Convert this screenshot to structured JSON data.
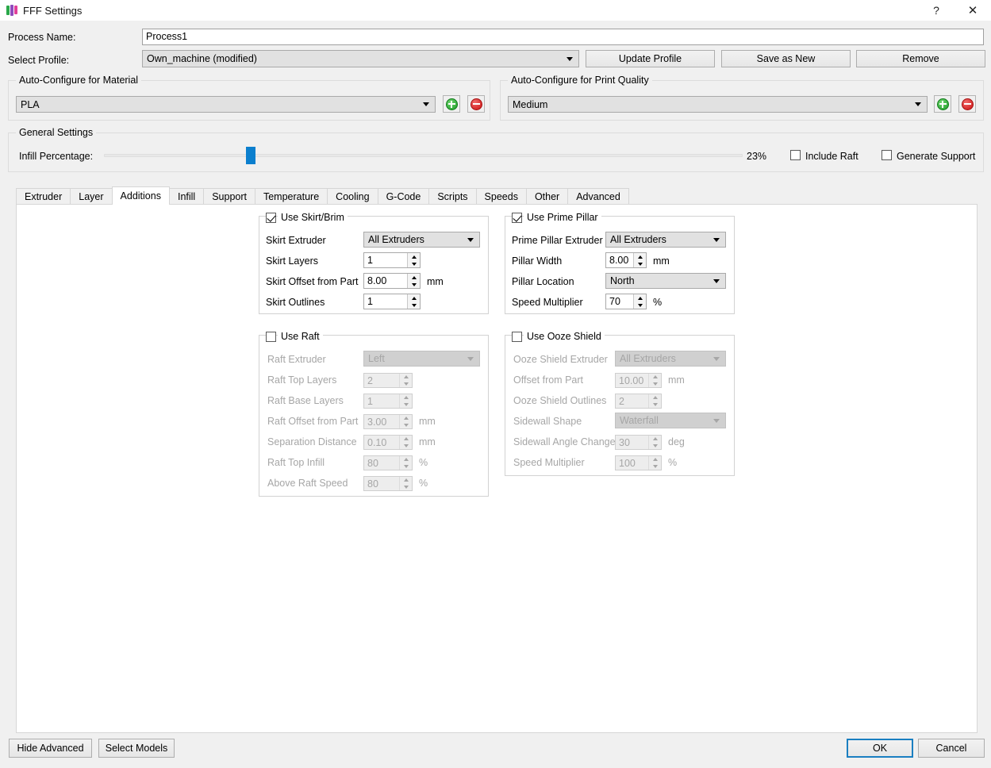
{
  "window": {
    "title": "FFF Settings",
    "icon": "simplify3d-logo-icon",
    "help_label": "?",
    "close_label": "✕"
  },
  "top_form": {
    "process_name_label": "Process Name:",
    "process_name_value": "Process1",
    "select_profile_label": "Select Profile:",
    "select_profile_value": "Own_machine (modified)",
    "update_profile_button": "Update Profile",
    "save_as_new_button": "Save as New",
    "remove_button": "Remove"
  },
  "material_group": {
    "title": "Auto-Configure for Material",
    "value": "PLA",
    "add_label": "+",
    "remove_label": "−"
  },
  "quality_group": {
    "title": "Auto-Configure for Print Quality",
    "value": "Medium",
    "add_label": "+",
    "remove_label": "−"
  },
  "general_settings": {
    "title": "General Settings",
    "infill_label": "Infill Percentage:",
    "infill_value": "23%",
    "infill_percent": 23,
    "include_raft_label": "Include Raft",
    "include_raft_checked": false,
    "generate_support_label": "Generate Support",
    "generate_support_checked": false
  },
  "tabs": [
    {
      "label": "Extruder",
      "active": false
    },
    {
      "label": "Layer",
      "active": false
    },
    {
      "label": "Additions",
      "active": true
    },
    {
      "label": "Infill",
      "active": false
    },
    {
      "label": "Support",
      "active": false
    },
    {
      "label": "Temperature",
      "active": false
    },
    {
      "label": "Cooling",
      "active": false
    },
    {
      "label": "G-Code",
      "active": false
    },
    {
      "label": "Scripts",
      "active": false
    },
    {
      "label": "Speeds",
      "active": false
    },
    {
      "label": "Other",
      "active": false
    },
    {
      "label": "Advanced",
      "active": false
    }
  ],
  "skirt_group": {
    "title": "Use Skirt/Brim",
    "checked": true,
    "extruder_label": "Skirt Extruder",
    "extruder_value": "All Extruders",
    "layers_label": "Skirt Layers",
    "layers_value": "1",
    "offset_label": "Skirt Offset from Part",
    "offset_value": "8.00",
    "offset_unit": "mm",
    "outlines_label": "Skirt Outlines",
    "outlines_value": "1"
  },
  "prime_pillar_group": {
    "title": "Use Prime Pillar",
    "checked": true,
    "extruder_label": "Prime Pillar Extruder",
    "extruder_value": "All Extruders",
    "width_label": "Pillar Width",
    "width_value": "8.00",
    "width_unit": "mm",
    "location_label": "Pillar Location",
    "location_value": "North",
    "speed_label": "Speed Multiplier",
    "speed_value": "70",
    "speed_unit": "%"
  },
  "raft_group": {
    "title": "Use Raft",
    "checked": false,
    "extruder_label": "Raft Extruder",
    "extruder_value": "Left",
    "top_layers_label": "Raft Top Layers",
    "top_layers_value": "2",
    "base_layers_label": "Raft Base Layers",
    "base_layers_value": "1",
    "offset_label": "Raft Offset from Part",
    "offset_value": "3.00",
    "offset_unit": "mm",
    "separation_label": "Separation Distance",
    "separation_value": "0.10",
    "separation_unit": "mm",
    "top_infill_label": "Raft Top Infill",
    "top_infill_value": "80",
    "top_infill_unit": "%",
    "above_speed_label": "Above Raft Speed",
    "above_speed_value": "80",
    "above_speed_unit": "%"
  },
  "ooze_group": {
    "title": "Use Ooze Shield",
    "checked": false,
    "extruder_label": "Ooze Shield Extruder",
    "extruder_value": "All Extruders",
    "offset_label": "Offset from Part",
    "offset_value": "10.00",
    "offset_unit": "mm",
    "outlines_label": "Ooze Shield Outlines",
    "outlines_value": "2",
    "sidewall_shape_label": "Sidewall Shape",
    "sidewall_shape_value": "Waterfall",
    "sidewall_angle_label": "Sidewall Angle Change",
    "sidewall_angle_value": "30",
    "sidewall_angle_unit": "deg",
    "speed_label": "Speed Multiplier",
    "speed_value": "100",
    "speed_unit": "%"
  },
  "footer": {
    "hide_advanced_button": "Hide Advanced",
    "select_models_button": "Select Models",
    "ok_button": "OK",
    "cancel_button": "Cancel"
  },
  "colors": {
    "accent_blue": "#0b7fce",
    "focus_blue": "#1a7fc1",
    "window_bg": "#f0f0f0",
    "panel_bg": "#ffffff",
    "green": "#1f9e28",
    "red": "#cc1111"
  }
}
